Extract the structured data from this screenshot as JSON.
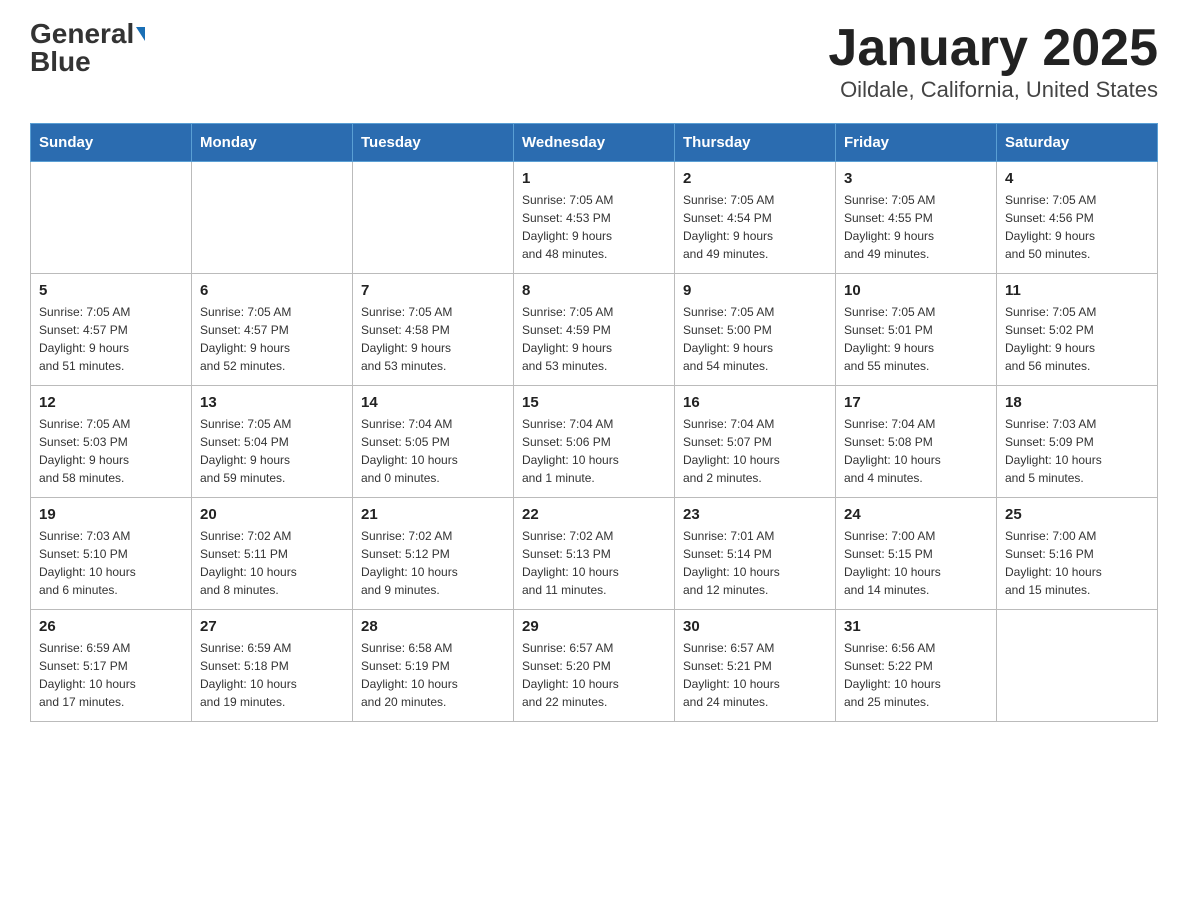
{
  "header": {
    "logo_main": "General",
    "logo_blue": "Blue",
    "title": "January 2025",
    "subtitle": "Oildale, California, United States"
  },
  "days_of_week": [
    "Sunday",
    "Monday",
    "Tuesday",
    "Wednesday",
    "Thursday",
    "Friday",
    "Saturday"
  ],
  "weeks": [
    [
      {
        "day": "",
        "info": ""
      },
      {
        "day": "",
        "info": ""
      },
      {
        "day": "",
        "info": ""
      },
      {
        "day": "1",
        "info": "Sunrise: 7:05 AM\nSunset: 4:53 PM\nDaylight: 9 hours\nand 48 minutes."
      },
      {
        "day": "2",
        "info": "Sunrise: 7:05 AM\nSunset: 4:54 PM\nDaylight: 9 hours\nand 49 minutes."
      },
      {
        "day": "3",
        "info": "Sunrise: 7:05 AM\nSunset: 4:55 PM\nDaylight: 9 hours\nand 49 minutes."
      },
      {
        "day": "4",
        "info": "Sunrise: 7:05 AM\nSunset: 4:56 PM\nDaylight: 9 hours\nand 50 minutes."
      }
    ],
    [
      {
        "day": "5",
        "info": "Sunrise: 7:05 AM\nSunset: 4:57 PM\nDaylight: 9 hours\nand 51 minutes."
      },
      {
        "day": "6",
        "info": "Sunrise: 7:05 AM\nSunset: 4:57 PM\nDaylight: 9 hours\nand 52 minutes."
      },
      {
        "day": "7",
        "info": "Sunrise: 7:05 AM\nSunset: 4:58 PM\nDaylight: 9 hours\nand 53 minutes."
      },
      {
        "day": "8",
        "info": "Sunrise: 7:05 AM\nSunset: 4:59 PM\nDaylight: 9 hours\nand 53 minutes."
      },
      {
        "day": "9",
        "info": "Sunrise: 7:05 AM\nSunset: 5:00 PM\nDaylight: 9 hours\nand 54 minutes."
      },
      {
        "day": "10",
        "info": "Sunrise: 7:05 AM\nSunset: 5:01 PM\nDaylight: 9 hours\nand 55 minutes."
      },
      {
        "day": "11",
        "info": "Sunrise: 7:05 AM\nSunset: 5:02 PM\nDaylight: 9 hours\nand 56 minutes."
      }
    ],
    [
      {
        "day": "12",
        "info": "Sunrise: 7:05 AM\nSunset: 5:03 PM\nDaylight: 9 hours\nand 58 minutes."
      },
      {
        "day": "13",
        "info": "Sunrise: 7:05 AM\nSunset: 5:04 PM\nDaylight: 9 hours\nand 59 minutes."
      },
      {
        "day": "14",
        "info": "Sunrise: 7:04 AM\nSunset: 5:05 PM\nDaylight: 10 hours\nand 0 minutes."
      },
      {
        "day": "15",
        "info": "Sunrise: 7:04 AM\nSunset: 5:06 PM\nDaylight: 10 hours\nand 1 minute."
      },
      {
        "day": "16",
        "info": "Sunrise: 7:04 AM\nSunset: 5:07 PM\nDaylight: 10 hours\nand 2 minutes."
      },
      {
        "day": "17",
        "info": "Sunrise: 7:04 AM\nSunset: 5:08 PM\nDaylight: 10 hours\nand 4 minutes."
      },
      {
        "day": "18",
        "info": "Sunrise: 7:03 AM\nSunset: 5:09 PM\nDaylight: 10 hours\nand 5 minutes."
      }
    ],
    [
      {
        "day": "19",
        "info": "Sunrise: 7:03 AM\nSunset: 5:10 PM\nDaylight: 10 hours\nand 6 minutes."
      },
      {
        "day": "20",
        "info": "Sunrise: 7:02 AM\nSunset: 5:11 PM\nDaylight: 10 hours\nand 8 minutes."
      },
      {
        "day": "21",
        "info": "Sunrise: 7:02 AM\nSunset: 5:12 PM\nDaylight: 10 hours\nand 9 minutes."
      },
      {
        "day": "22",
        "info": "Sunrise: 7:02 AM\nSunset: 5:13 PM\nDaylight: 10 hours\nand 11 minutes."
      },
      {
        "day": "23",
        "info": "Sunrise: 7:01 AM\nSunset: 5:14 PM\nDaylight: 10 hours\nand 12 minutes."
      },
      {
        "day": "24",
        "info": "Sunrise: 7:00 AM\nSunset: 5:15 PM\nDaylight: 10 hours\nand 14 minutes."
      },
      {
        "day": "25",
        "info": "Sunrise: 7:00 AM\nSunset: 5:16 PM\nDaylight: 10 hours\nand 15 minutes."
      }
    ],
    [
      {
        "day": "26",
        "info": "Sunrise: 6:59 AM\nSunset: 5:17 PM\nDaylight: 10 hours\nand 17 minutes."
      },
      {
        "day": "27",
        "info": "Sunrise: 6:59 AM\nSunset: 5:18 PM\nDaylight: 10 hours\nand 19 minutes."
      },
      {
        "day": "28",
        "info": "Sunrise: 6:58 AM\nSunset: 5:19 PM\nDaylight: 10 hours\nand 20 minutes."
      },
      {
        "day": "29",
        "info": "Sunrise: 6:57 AM\nSunset: 5:20 PM\nDaylight: 10 hours\nand 22 minutes."
      },
      {
        "day": "30",
        "info": "Sunrise: 6:57 AM\nSunset: 5:21 PM\nDaylight: 10 hours\nand 24 minutes."
      },
      {
        "day": "31",
        "info": "Sunrise: 6:56 AM\nSunset: 5:22 PM\nDaylight: 10 hours\nand 25 minutes."
      },
      {
        "day": "",
        "info": ""
      }
    ]
  ]
}
